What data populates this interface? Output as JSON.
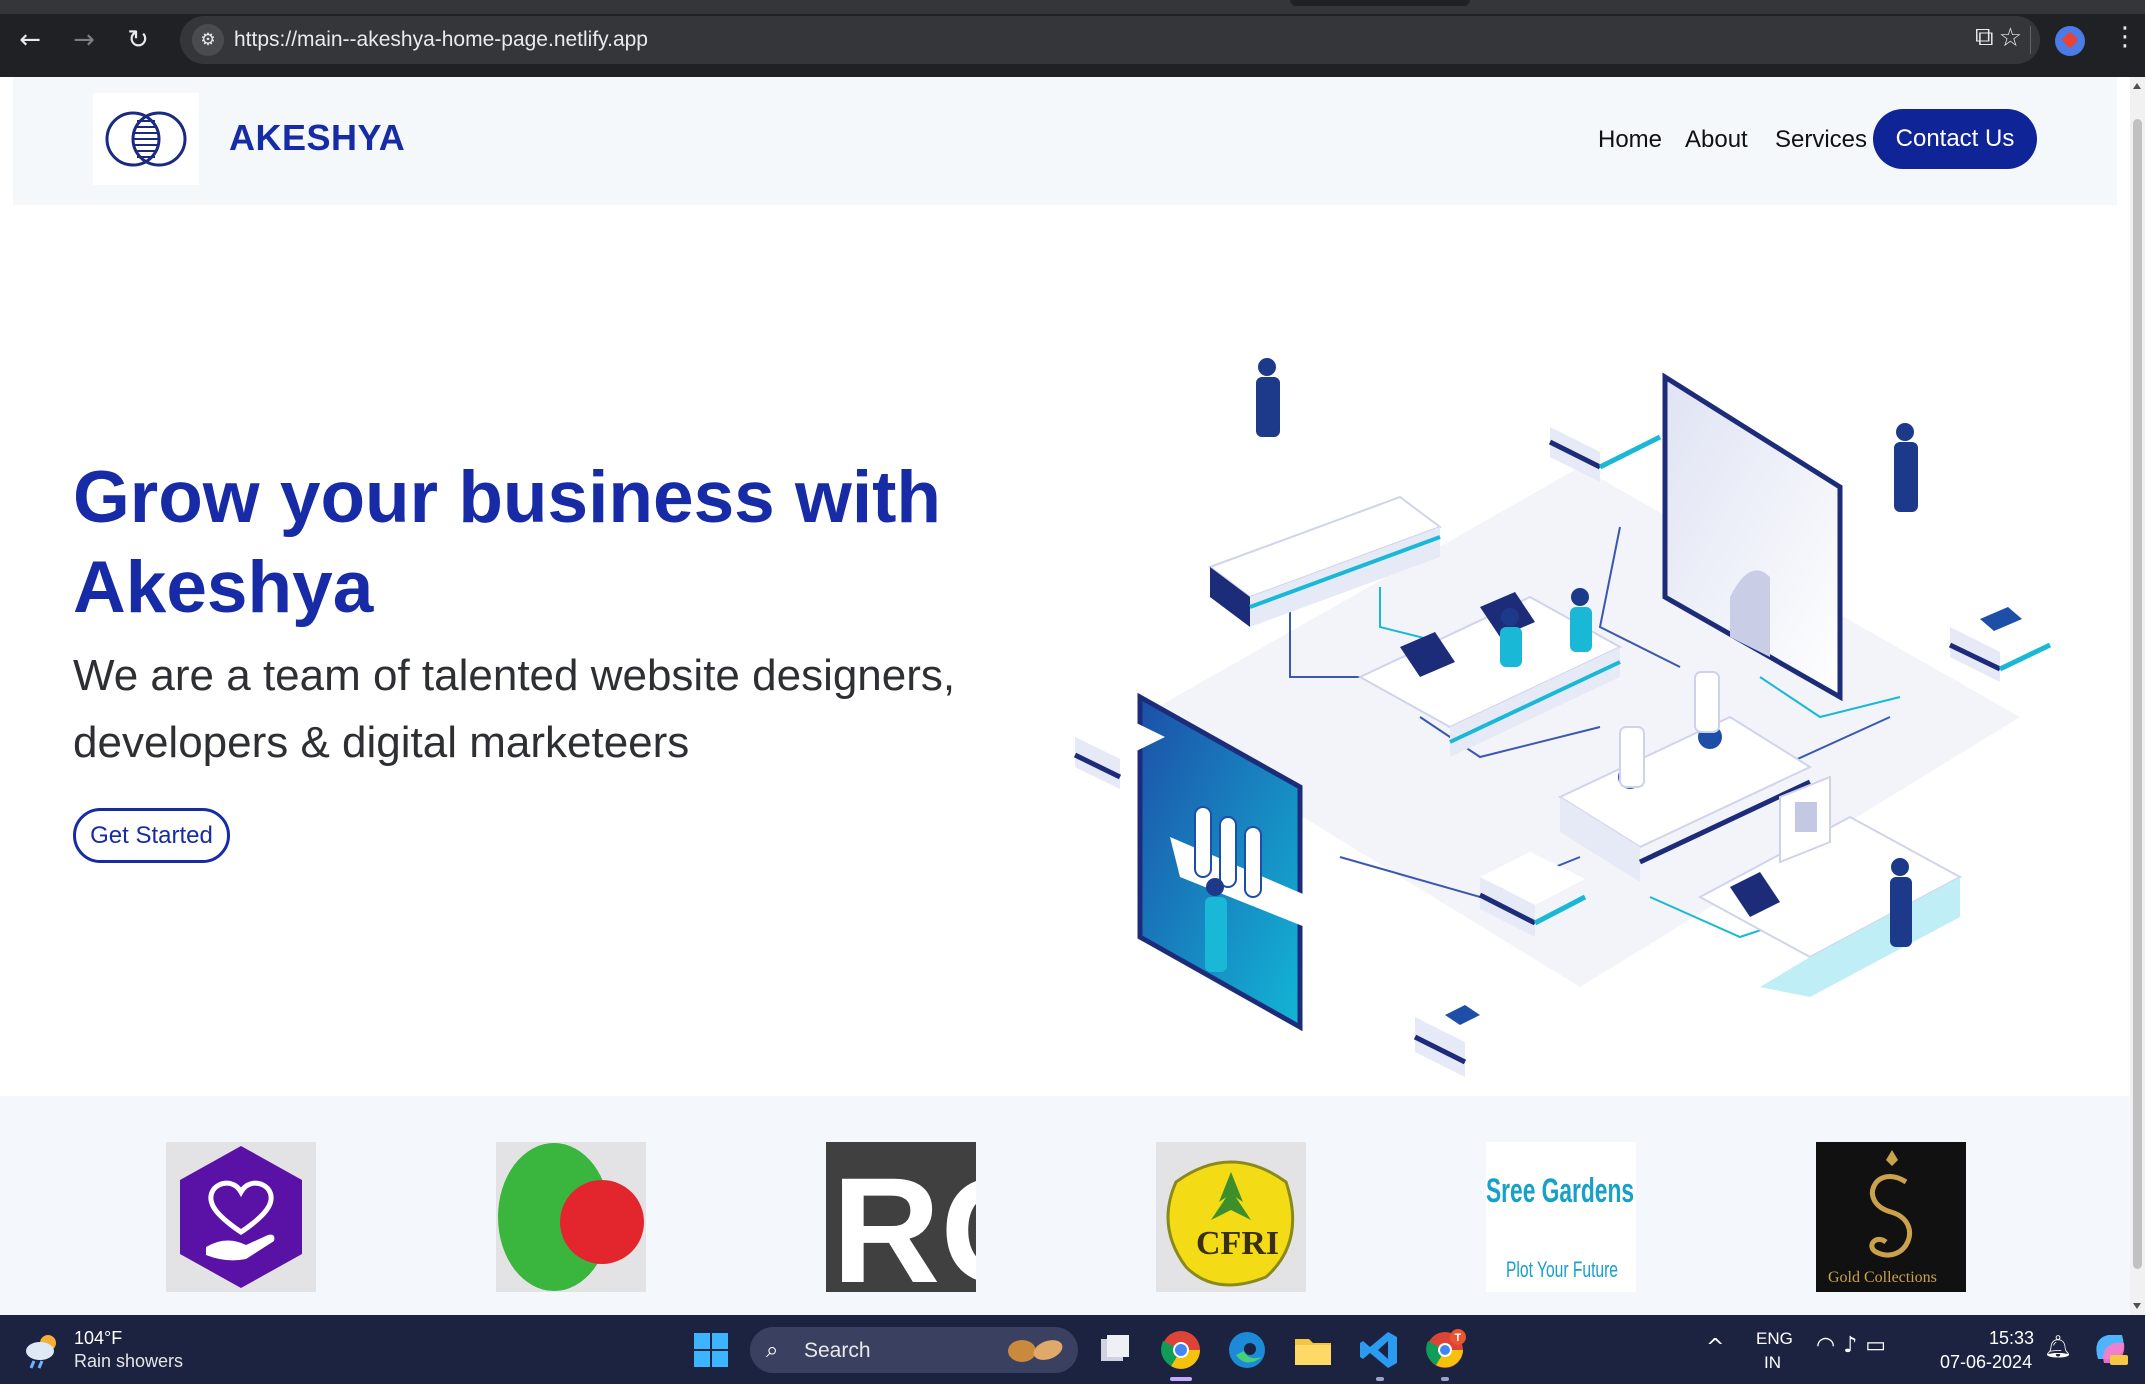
{
  "browser": {
    "url": "https://main--akeshya-home-page.netlify.app",
    "icons": {
      "back": "arrow-left-icon",
      "forward": "arrow-right-icon",
      "reload": "reload-icon",
      "site_info": "tune-icon",
      "bookmark": "star-icon",
      "extensions": "puzzle-icon",
      "menu": "kebab-menu-icon"
    }
  },
  "header": {
    "brand": "AKESHYA",
    "nav": [
      "Home",
      "About",
      "Services"
    ],
    "contact_label": "Contact Us",
    "accent_color": "#172ba6"
  },
  "hero": {
    "title": "Grow your business with Akeshya",
    "subtitle": "We are a team of talented website designers, developers & digital marketeers",
    "cta_label": "Get Started"
  },
  "clients": {
    "logos": [
      {
        "name": "purple-hexagon-heart-hand-logo"
      },
      {
        "name": "green-red-circles-logo"
      },
      {
        "name": "ro-logo",
        "text": "RO"
      },
      {
        "name": "cfri-logo",
        "text": "CFRI"
      },
      {
        "name": "sree-gardens-logo",
        "text": "Sree Gardens",
        "tagline": "Plot Your Future"
      },
      {
        "name": "gold-collections-logo",
        "text": "Gold Collections"
      }
    ]
  },
  "taskbar": {
    "temperature": "104°F",
    "weather": "Rain showers",
    "search_label": "Search",
    "lang_line1": "ENG",
    "lang_line2": "IN",
    "time": "15:33",
    "date": "07-06-2024",
    "badge": "T"
  }
}
